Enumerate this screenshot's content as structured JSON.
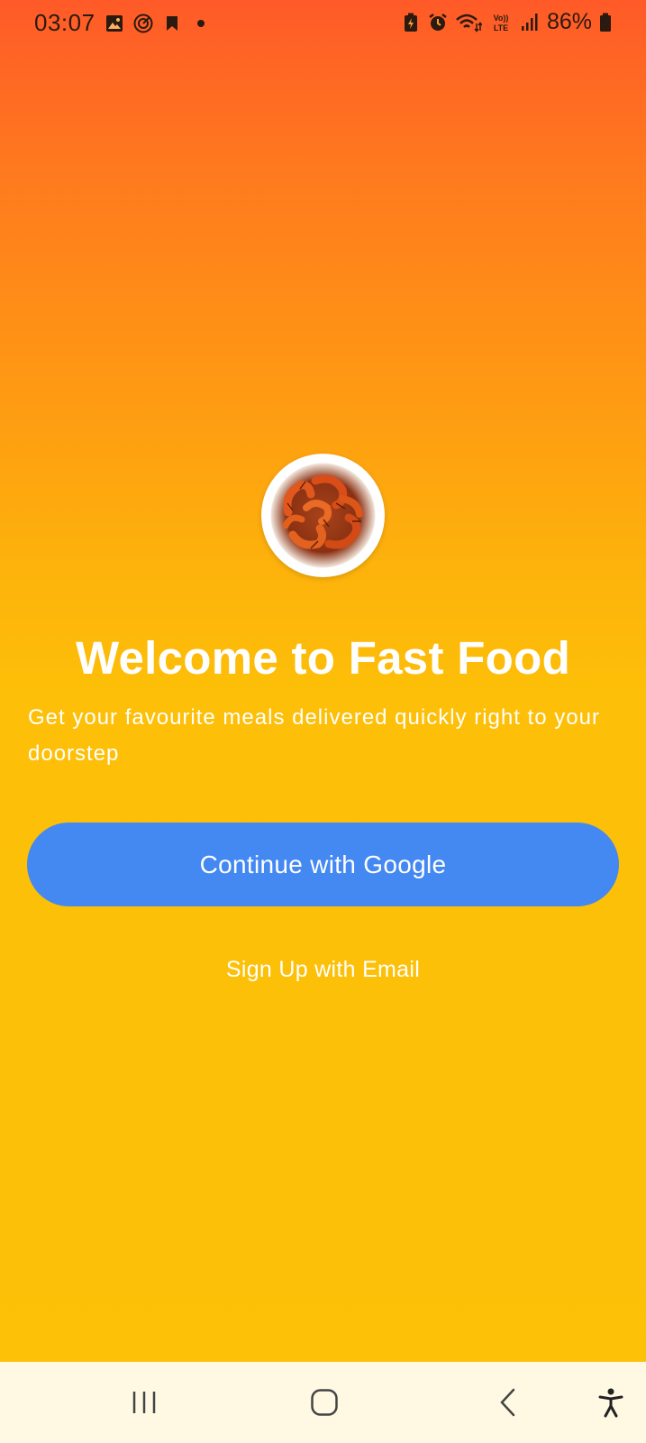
{
  "status_bar": {
    "time": "03:07",
    "battery": "86%",
    "left_icons": [
      "gallery-icon",
      "target-icon",
      "bookmark-icon",
      "dot-icon"
    ],
    "right_icons": [
      "battery-saver-icon",
      "alarm-icon",
      "wifi-icon",
      "volte-icon",
      "signal-icon",
      "battery-icon"
    ],
    "volte_text": "Vo)) LTE"
  },
  "welcome": {
    "logo": "shrimp-bowl-logo",
    "title": "Welcome to Fast Food",
    "subtitle": "Get your favourite meals delivered quickly right to your doorstep"
  },
  "actions": {
    "google_label": "Continue with Google",
    "email_label": "Sign Up with Email"
  },
  "nav_bar": {
    "items": [
      "recents-icon",
      "home-icon",
      "back-icon",
      "accessibility-icon"
    ]
  },
  "colors": {
    "gradient_top": "#ff5a28",
    "gradient_bottom": "#fdc108",
    "google_button": "#4488f1",
    "nav_bar_bg": "#fff8e3"
  }
}
